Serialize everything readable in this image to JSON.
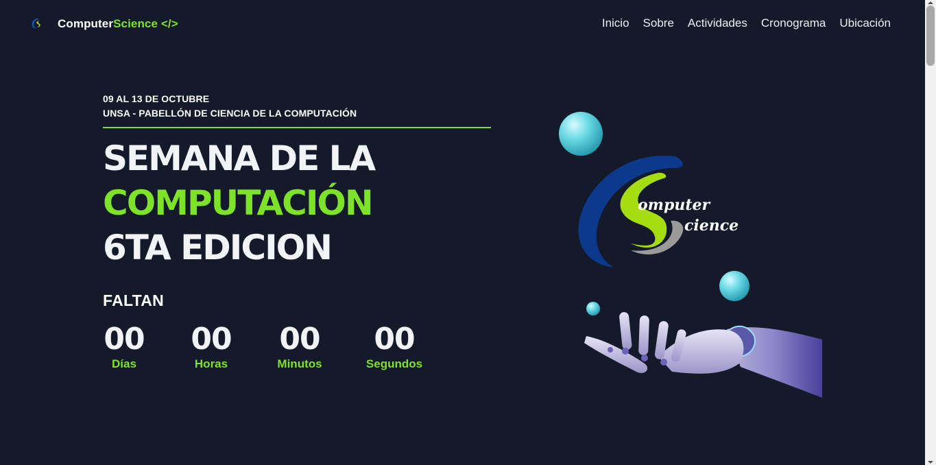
{
  "brand": {
    "name_part1": "Computer",
    "name_part2": "Science </>",
    "logo_icon": "computer-science-logo-icon"
  },
  "nav": {
    "items": [
      {
        "label": "Inicio"
      },
      {
        "label": "Sobre"
      },
      {
        "label": "Actividades"
      },
      {
        "label": "Cronograma"
      },
      {
        "label": "Ubicación"
      }
    ]
  },
  "hero": {
    "date": "09 AL 13 DE OCTUBRE",
    "place": "UNSA - PABELLÓN DE CIENCIA DE LA COMPUTACIÓN",
    "title_line1": "SEMANA DE LA",
    "title_line2": "COMPUTACIÓN",
    "title_line3": "6TA EDICION",
    "countdown_heading": "FALTAN",
    "countdown": [
      {
        "value": "00",
        "label": "Días"
      },
      {
        "value": "00",
        "label": "Horas"
      },
      {
        "value": "00",
        "label": "Minutos"
      },
      {
        "value": "00",
        "label": "Segundos"
      }
    ],
    "art": {
      "logo_text_1": "omputer",
      "logo_text_2": "cience",
      "description_icon": "robot-hand-illustration"
    }
  },
  "colors": {
    "background": "#141a2a",
    "accent_green": "#7ee22a",
    "logo_blue": "#0b3a8c",
    "sphere_cyan": "#5fd4e0"
  }
}
